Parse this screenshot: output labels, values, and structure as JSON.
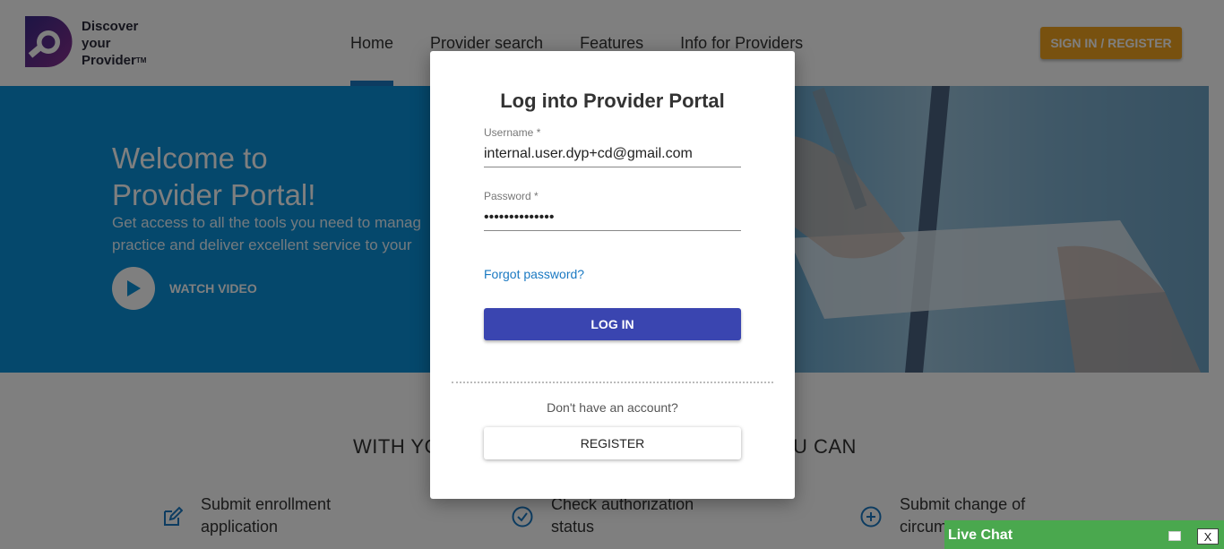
{
  "brand": {
    "line1": "Discover",
    "line2": "your",
    "line3": "Provider",
    "tm": "TM",
    "colors": {
      "dark": "#2b2b3a",
      "purple": "#6b2c91",
      "blue": "#1a79c2"
    }
  },
  "nav": {
    "items": [
      {
        "label": "Home",
        "active": true
      },
      {
        "label": "Provider search",
        "active": false
      },
      {
        "label": "Features",
        "active": false
      },
      {
        "label": "Info for Providers",
        "active": false
      }
    ],
    "signin_label": "SIGN IN / REGISTER"
  },
  "hero": {
    "title_line1": "Welcome to",
    "title_line2": "Provider Portal!",
    "subtitle_line1": "Get access to all the tools you need to manag",
    "subtitle_line2": "practice and deliver excellent service to your",
    "watch_label": "WATCH VIDEO"
  },
  "section": {
    "heading_left": "WITH YO",
    "heading_right": "U CAN",
    "features": [
      {
        "icon": "edit-icon",
        "line1": "Submit enrollment",
        "line2": "application"
      },
      {
        "icon": "check-circle-icon",
        "line1": "Check authorization",
        "line2": "status"
      },
      {
        "icon": "plus-circle-icon",
        "line1": "Submit change of",
        "line2": "circum"
      }
    ]
  },
  "modal": {
    "title": "Log into Provider Portal",
    "username_label": "Username *",
    "username_value": "internal.user.dyp+cd@gmail.com",
    "password_label": "Password *",
    "password_value": "••••••••••••••",
    "forgot_label": "Forgot password?",
    "login_label": "LOG IN",
    "no_account_text": "Don't have an account?",
    "register_label": "REGISTER"
  },
  "livechat": {
    "label": "Live Chat",
    "close_label": "X",
    "color": "#4aa84e"
  }
}
